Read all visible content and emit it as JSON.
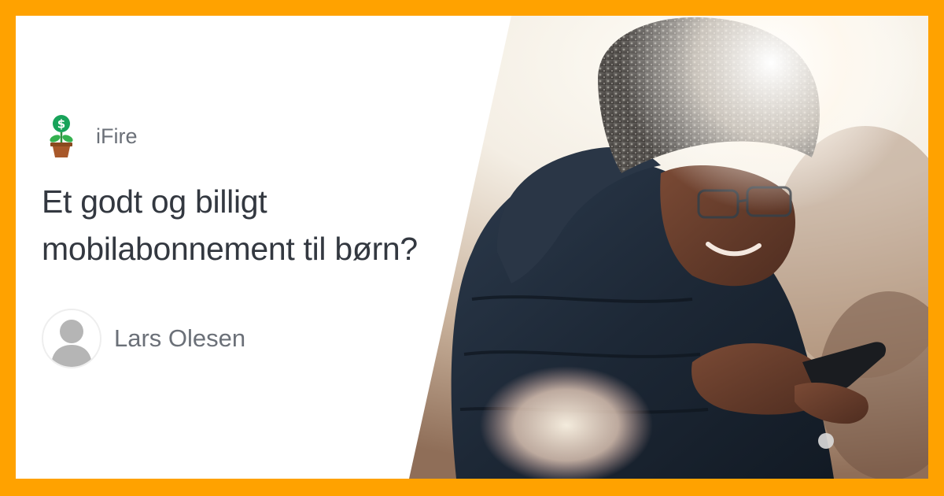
{
  "brand": {
    "name": "iFire",
    "logo_icon": "money-plant-icon",
    "logo_symbol": "$"
  },
  "article": {
    "title_line1": "Et godt og billigt",
    "title_line2": "mobilabonnement til børn?"
  },
  "author": {
    "name": "Lars Olesen",
    "avatar_icon": "default-user-avatar-icon"
  },
  "colors": {
    "frame": "#ffa200",
    "title_text": "#333840",
    "muted_text": "#6b7078"
  },
  "hero_image": {
    "subject": "woman-looking-at-phone-photo"
  }
}
